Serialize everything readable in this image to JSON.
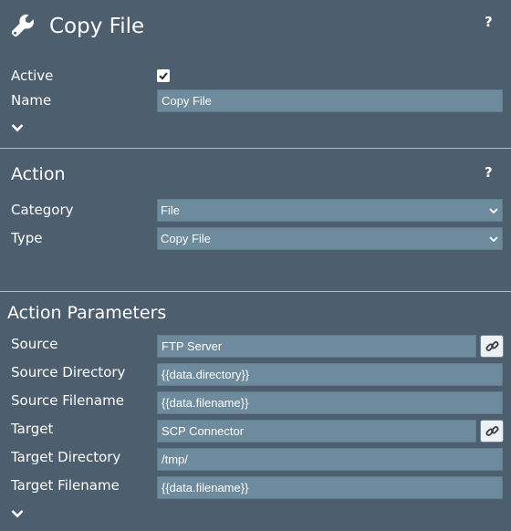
{
  "header": {
    "title": "Copy File",
    "help": "?"
  },
  "general": {
    "active_label": "Active",
    "active_checked": true,
    "name_label": "Name",
    "name_value": "Copy File"
  },
  "action": {
    "title": "Action",
    "help": "?",
    "category_label": "Category",
    "category_value": "File",
    "type_label": "Type",
    "type_value": "Copy File"
  },
  "params": {
    "title": "Action Parameters",
    "source_label": "Source",
    "source_value": "FTP Server",
    "source_dir_label": "Source Directory",
    "source_dir_value": "{{data.directory}}",
    "source_file_label": "Source Filename",
    "source_file_value": "{{data.filename}}",
    "target_label": "Target",
    "target_value": "SCP Connector",
    "target_dir_label": "Target Directory",
    "target_dir_value": "/tmp/",
    "target_file_label": "Target Filename",
    "target_file_value": "{{data.filename}}"
  },
  "icons": {
    "header": "wrench-icon",
    "help": "question-icon",
    "expand": "chevron-down-icon",
    "link": "link-icon",
    "check": "checkmark-icon"
  }
}
